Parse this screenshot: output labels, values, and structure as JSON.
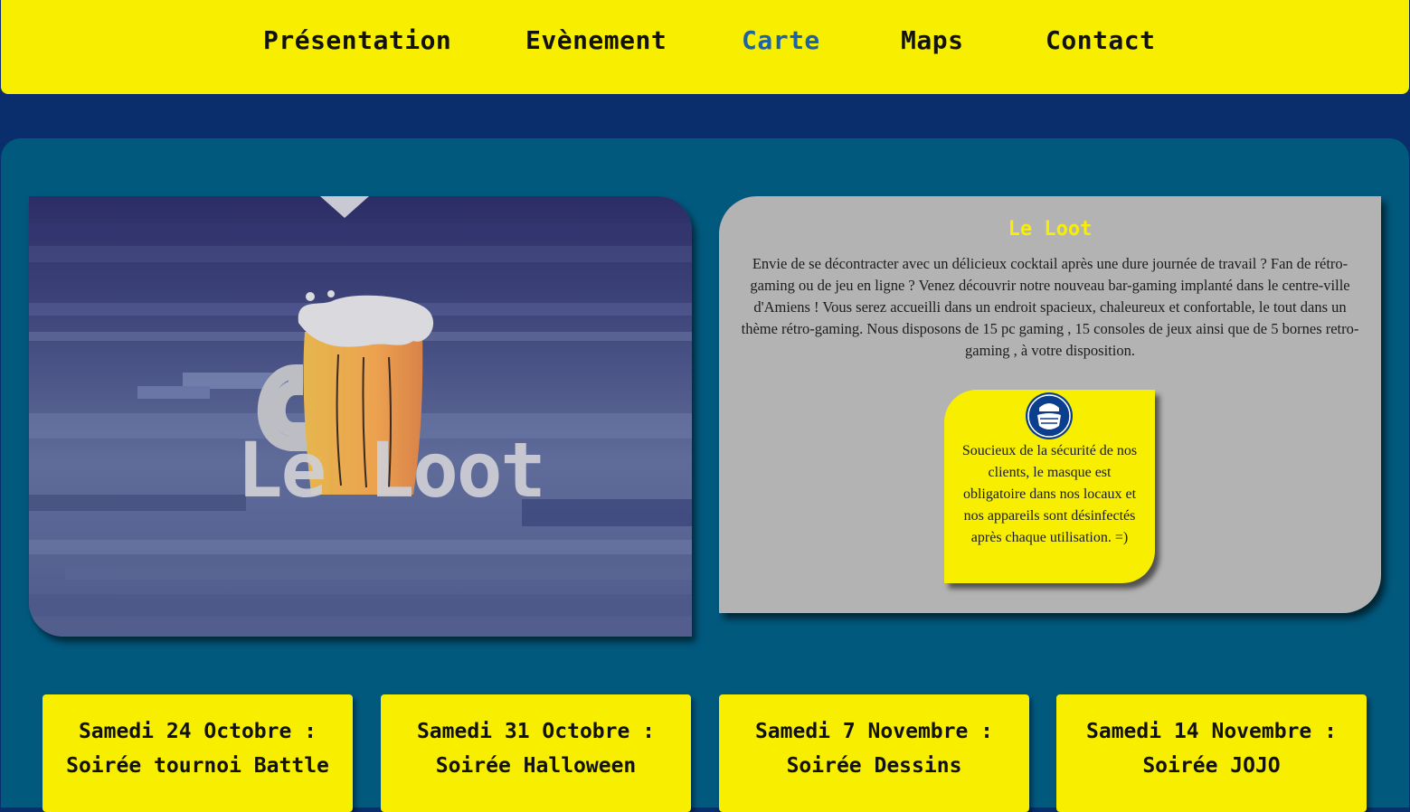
{
  "nav": {
    "items": [
      {
        "label": "Présentation"
      },
      {
        "label": "Evènement"
      },
      {
        "label": "Carte"
      },
      {
        "label": "Maps"
      },
      {
        "label": "Contact"
      }
    ],
    "active_label": "Carte"
  },
  "hero": {
    "logo_text": "Le Loot",
    "icon": "beer-mug-icon"
  },
  "info": {
    "title": "Le Loot",
    "text": "Envie de se décontracter avec un délicieux cocktail après une dure journée de travail ? Fan de rétro-gaming ou de jeu en ligne ? Venez découvrir notre nouveau bar-gaming implanté dans le centre-ville d'Amiens ! Vous serez accueilli dans un endroit spacieux, chaleureux et confortable, le tout dans un thème rétro-gaming. Nous disposons de 15 pc gaming , 15 consoles de jeux ainsi que de 5 bornes retro-gaming , à votre disposition.",
    "mask_notice": {
      "icon": "face-mask-icon",
      "text": "Soucieux de la sécurité de nos clients, le masque est obligatoire dans nos locaux et nos appareils sont désinfectés après chaque utilisation. =)"
    }
  },
  "events": [
    {
      "date": "Samedi 24 Octobre :",
      "title": "Soirée tournoi Battle"
    },
    {
      "date": "Samedi 31 Octobre :",
      "title": "Soirée Halloween"
    },
    {
      "date": "Samedi 7 Novembre :",
      "title": "Soirée Dessins"
    },
    {
      "date": "Samedi 14 Novembre :",
      "title": "Soirée JOJO"
    }
  ],
  "colors": {
    "accent_yellow": "#f7ee00",
    "active_link": "#1e62a8",
    "page_bg": "#0a2d6b",
    "panel_bg": "#02597e",
    "card_grey": "#b3b3b3"
  }
}
